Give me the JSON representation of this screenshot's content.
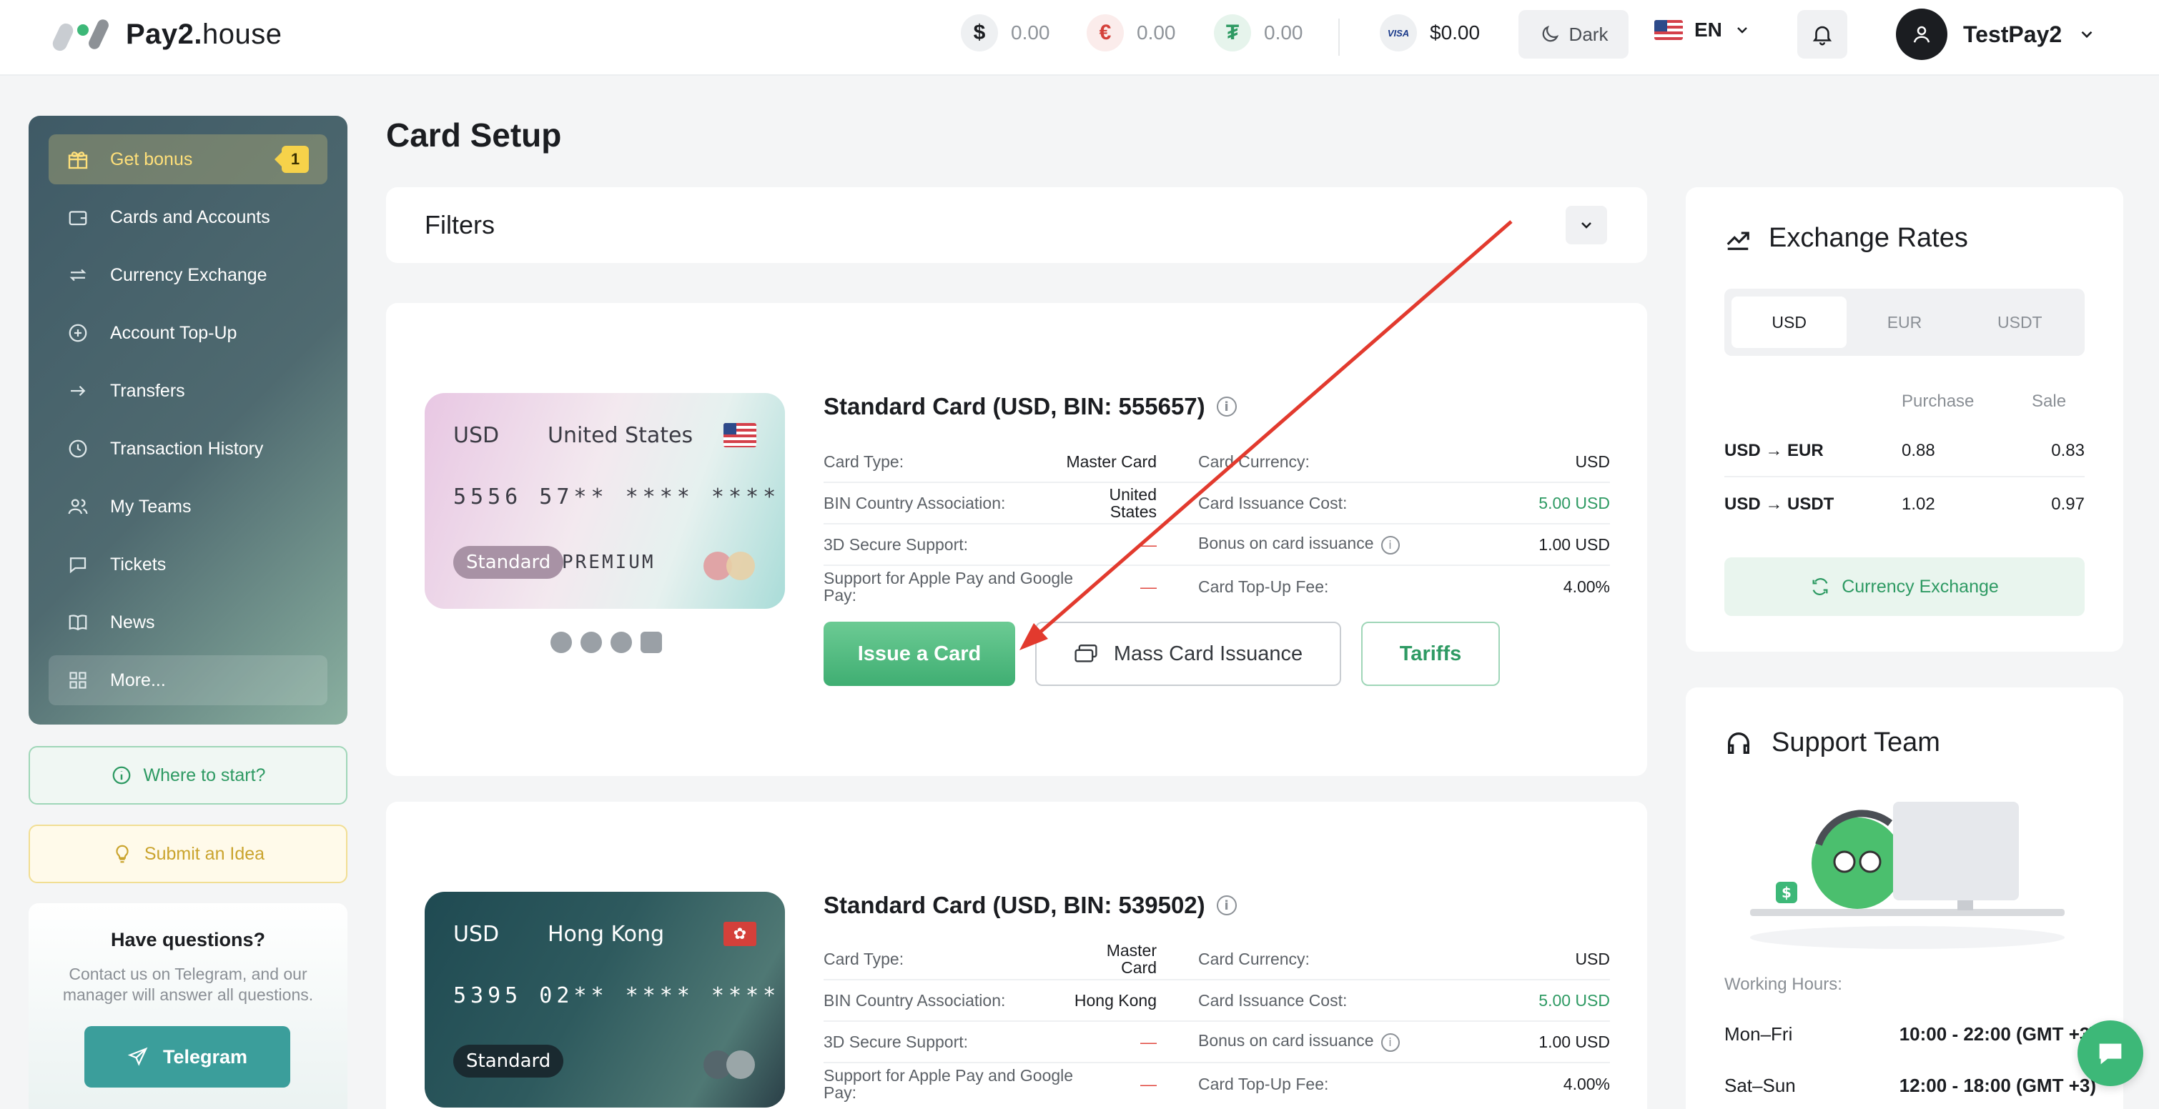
{
  "brand": {
    "name_bold": "Pay2.",
    "name_rest": "house"
  },
  "header": {
    "balances": [
      {
        "symbol": "$",
        "value": "0.00",
        "color": "#1b1d21",
        "bg": "#eef0f2"
      },
      {
        "symbol": "€",
        "value": "0.00",
        "color": "#d4403a",
        "bg": "#fbeceb"
      },
      {
        "symbol": "₮",
        "value": "0.00",
        "color": "#2e9a63",
        "bg": "#e6f4ec"
      }
    ],
    "card_balance": {
      "brand": "VISA",
      "value": "$0.00"
    },
    "theme_label": "Dark",
    "language": "EN",
    "username": "TestPay2"
  },
  "sidebar": {
    "items": [
      {
        "label": "Get bonus",
        "icon": "gift-icon",
        "badge": "1"
      },
      {
        "label": "Cards and Accounts",
        "icon": "wallet-icon"
      },
      {
        "label": "Currency Exchange",
        "icon": "exchange-icon"
      },
      {
        "label": "Account Top-Up",
        "icon": "plus-circle-icon"
      },
      {
        "label": "Transfers",
        "icon": "arrow-right-icon"
      },
      {
        "label": "Transaction History",
        "icon": "clock-icon"
      },
      {
        "label": "My Teams",
        "icon": "users-icon"
      },
      {
        "label": "Tickets",
        "icon": "chat-icon"
      },
      {
        "label": "News",
        "icon": "book-icon"
      },
      {
        "label": "More...",
        "icon": "grid-icon"
      }
    ],
    "where_to_start": "Where to start?",
    "submit_idea": "Submit an Idea",
    "help": {
      "title": "Have questions?",
      "text": "Contact us on Telegram, and our manager will answer all questions.",
      "button": "Telegram"
    }
  },
  "main": {
    "title": "Card Setup",
    "filters_label": "Filters",
    "cards": [
      {
        "title": "Standard Card (USD, BIN: 555657)",
        "visual": {
          "currency": "USD",
          "country": "United States",
          "number": "5556 57** **** ****",
          "tier": "Standard",
          "extra": "PREMIUM"
        },
        "left": [
          {
            "k": "Card Type:",
            "v": "Master Card"
          },
          {
            "k": "BIN Country Association:",
            "v": "United States"
          },
          {
            "k": "3D Secure Support:",
            "v": "—"
          },
          {
            "k": "Support for Apple Pay and Google Pay:",
            "v": "—"
          }
        ],
        "right": [
          {
            "k": "Card Currency:",
            "v": "USD"
          },
          {
            "k": "Card Issuance Cost:",
            "v": "5.00 USD"
          },
          {
            "k": "Bonus on card issuance",
            "v": "1.00 USD"
          },
          {
            "k": "Card Top-Up Fee:",
            "v": "4.00%"
          }
        ],
        "buttons": {
          "issue": "Issue a Card",
          "mass": "Mass Card Issuance",
          "tariffs": "Tariffs"
        }
      },
      {
        "title": "Standard Card (USD, BIN: 539502)",
        "visual": {
          "currency": "USD",
          "country": "Hong Kong",
          "number": "5395 02** **** ****",
          "tier": "Standard"
        },
        "left": [
          {
            "k": "Card Type:",
            "v": "Master Card"
          },
          {
            "k": "BIN Country Association:",
            "v": "Hong Kong"
          },
          {
            "k": "3D Secure Support:",
            "v": "—"
          },
          {
            "k": "Support for Apple Pay and Google Pay:",
            "v": "—"
          }
        ],
        "right": [
          {
            "k": "Card Currency:",
            "v": "USD"
          },
          {
            "k": "Card Issuance Cost:",
            "v": "5.00 USD"
          },
          {
            "k": "Bonus on card issuance",
            "v": "1.00 USD"
          },
          {
            "k": "Card Top-Up Fee:",
            "v": "4.00%"
          }
        ]
      }
    ]
  },
  "rates": {
    "title": "Exchange Rates",
    "tabs": [
      "USD",
      "EUR",
      "USDT"
    ],
    "col_purchase": "Purchase",
    "col_sale": "Sale",
    "rows": [
      {
        "pair": "USD → EUR",
        "purchase": "0.88",
        "sale": "0.83"
      },
      {
        "pair": "USD → USDT",
        "purchase": "1.02",
        "sale": "0.97"
      }
    ],
    "button": "Currency Exchange"
  },
  "support": {
    "title": "Support Team",
    "hours_label": "Working Hours:",
    "hours": [
      {
        "days": "Mon–Fri",
        "time": "10:00 - 22:00 (GMT +3)"
      },
      {
        "days": "Sat–Sun",
        "time": "12:00 - 18:00 (GMT +3)"
      }
    ]
  }
}
